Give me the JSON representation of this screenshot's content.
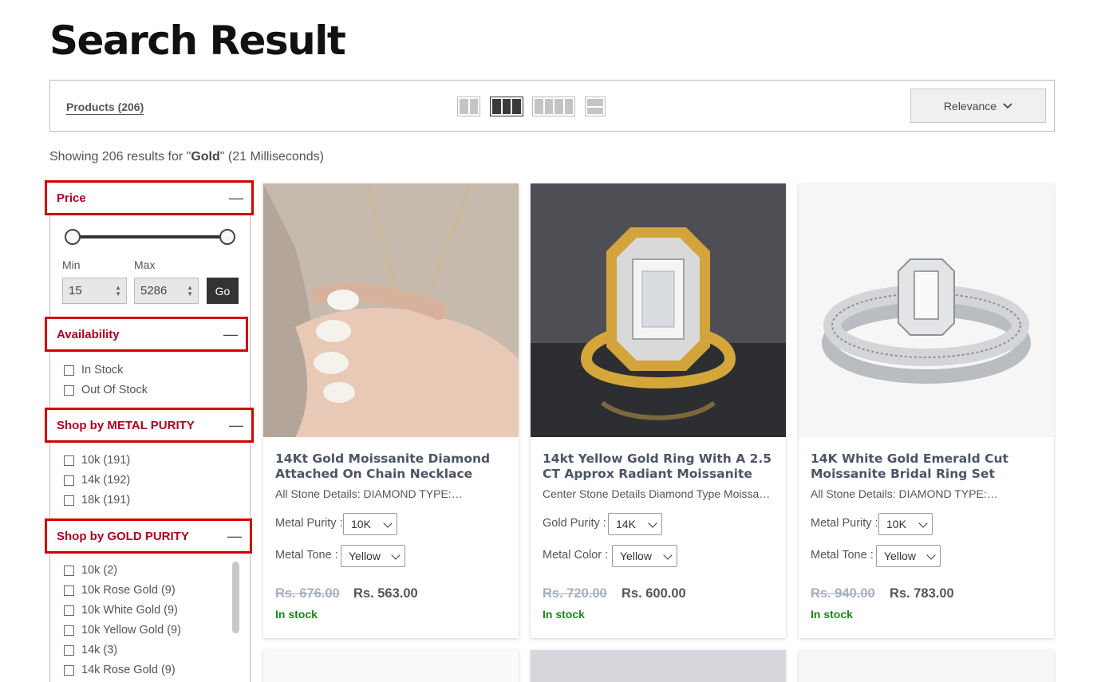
{
  "page": {
    "title": "Search Result"
  },
  "toolbar": {
    "products_label": "Products (206)",
    "sort_label": "Relevance",
    "active_view": "3-column"
  },
  "results": {
    "prefix": "Showing 206 results for \"",
    "query": "Gold",
    "suffix": "\" (21 Milliseconds)"
  },
  "filters": {
    "price": {
      "title": "Price",
      "min_label": "Min",
      "max_label": "Max",
      "min_value": "15",
      "max_value": "5286",
      "go_label": "Go"
    },
    "availability": {
      "title": "Availability",
      "options": [
        "In Stock",
        "Out Of Stock"
      ]
    },
    "metal_purity": {
      "title": "Shop by METAL PURITY",
      "options": [
        "10k (191)",
        "14k (192)",
        "18k (191)"
      ]
    },
    "gold_purity": {
      "title": "Shop by GOLD PURITY",
      "options": [
        "10k (2)",
        "10k Rose Gold (9)",
        "10k White Gold (9)",
        "10k Yellow Gold (9)",
        "14k (3)",
        "14k Rose Gold (9)"
      ]
    }
  },
  "products": [
    {
      "name": "14Kt Gold Moissanite Diamond Attached On Chain Necklace",
      "desc": "All Stone Details: DIAMOND TYPE:…",
      "opt1_label": "Metal Purity :",
      "opt1_value": "10K",
      "opt2_label": "Metal Tone :",
      "opt2_value": "Yellow",
      "old_price": "Rs. 676.00",
      "price": "Rs. 563.00",
      "stock": "In stock"
    },
    {
      "name": "14kt Yellow Gold Ring With A 2.5 CT Approx Radiant Moissanite",
      "desc": "Center Stone Details Diamond Type Moissani…",
      "opt1_label": "Gold Purity :",
      "opt1_value": "14K",
      "opt2_label": "Metal Color :",
      "opt2_value": "Yellow",
      "old_price": "Rs. 720.00",
      "price": "Rs. 600.00",
      "stock": "In stock"
    },
    {
      "name": "14K White Gold Emerald Cut Moissanite Bridal Ring Set",
      "desc": "All Stone Details: DIAMOND TYPE:…",
      "opt1_label": "Metal Purity :",
      "opt1_value": "10K",
      "opt2_label": "Metal Tone :",
      "opt2_value": "Yellow",
      "old_price": "Rs. 940.00",
      "price": "Rs. 783.00",
      "stock": "In stock"
    }
  ],
  "colors": {
    "filter_title": "#b00020",
    "highlight_border": "#d40000",
    "in_stock": "#168a16",
    "old_price": "#a6b0bf"
  },
  "icons": {
    "collapse": "minus-icon",
    "sort": "chevron-down-icon"
  }
}
